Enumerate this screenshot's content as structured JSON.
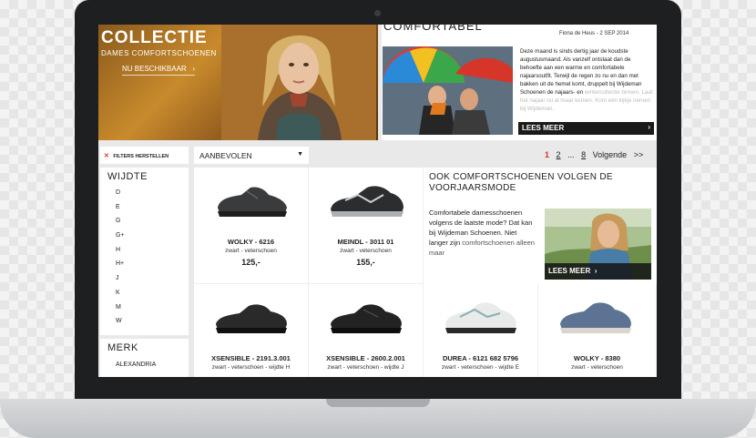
{
  "hero": {
    "title": "COLLECTIE",
    "subtitle": "DAMES COMFORTSCHOENEN",
    "cta": "NU BESCHIKBAAR"
  },
  "blog": {
    "title": "COMFORTABEL",
    "meta": "Fiona de Heus - 2 SEP 2014",
    "text": "Deze maand is sinds dertig jaar de koudste augustusmaand. Als vanzelf ontstaat dan de behoefte aan een warme en comfortabele najaarsoutfit. Terwijl de regen zo nu en dan met bakken uit de hemel komt, druppelt bij Wijdeman Schoenen de najaars- en",
    "text_faded": "wintercollectie binnen. Laat het najaar nu al maar komen. Kom een kijkje nemen bij Wijdeman.",
    "more_label": "LEES MEER"
  },
  "toolbar": {
    "filters_reset": "FILTERS HERSTELLEN",
    "sort_value": "AANBEVOLEN",
    "pager": {
      "current": "1",
      "page2": "2",
      "ellipsis": "...",
      "last": "8",
      "next": "Volgende",
      "next_arrows": ">>"
    }
  },
  "sidebar": {
    "width_heading": "WIJDTE",
    "widths": [
      "D",
      "E",
      "G",
      "G+",
      "H",
      "H+",
      "J",
      "K",
      "M",
      "W"
    ],
    "brand_heading": "MERK",
    "brands": [
      "ALEXANDRIA"
    ]
  },
  "products": [
    {
      "name": "WOLKY - 6216",
      "desc": "zwart - veterschoen",
      "price": "125,-"
    },
    {
      "name": "MEINDL - 3011 01",
      "desc": "zwart - veterschoen",
      "price": "155,-"
    },
    {
      "name": "XSENSIBLE - 2191.3.001",
      "desc": "zwart - veterschoen - wijdte H",
      "price": ""
    },
    {
      "name": "XSENSIBLE - 2600.2.001",
      "desc": "zwart - veterschoen - wijdte J",
      "price": ""
    },
    {
      "name": "DUREA - 6121 682 5796",
      "desc": "zwart - veterschoen - wijdte E",
      "price": ""
    },
    {
      "name": "WOLKY - 8380",
      "desc": "zwart - veterschoen",
      "price": ""
    }
  ],
  "promo": {
    "title": "OOK COMFORTSCHOENEN VOLGEN DE VOORJAARSMODE",
    "text": "Comfortabele damesschoenen volgens de laatste mode? Dat kan bij Wijdeman Schoenen. Niet langer zijn",
    "link": "comfortschoenen alleen maar",
    "more_label": "LEES MEER"
  },
  "colors": {
    "accent": "#dd3322",
    "bezel": "#1d1f21",
    "button_dark": "#1a1a1a"
  }
}
